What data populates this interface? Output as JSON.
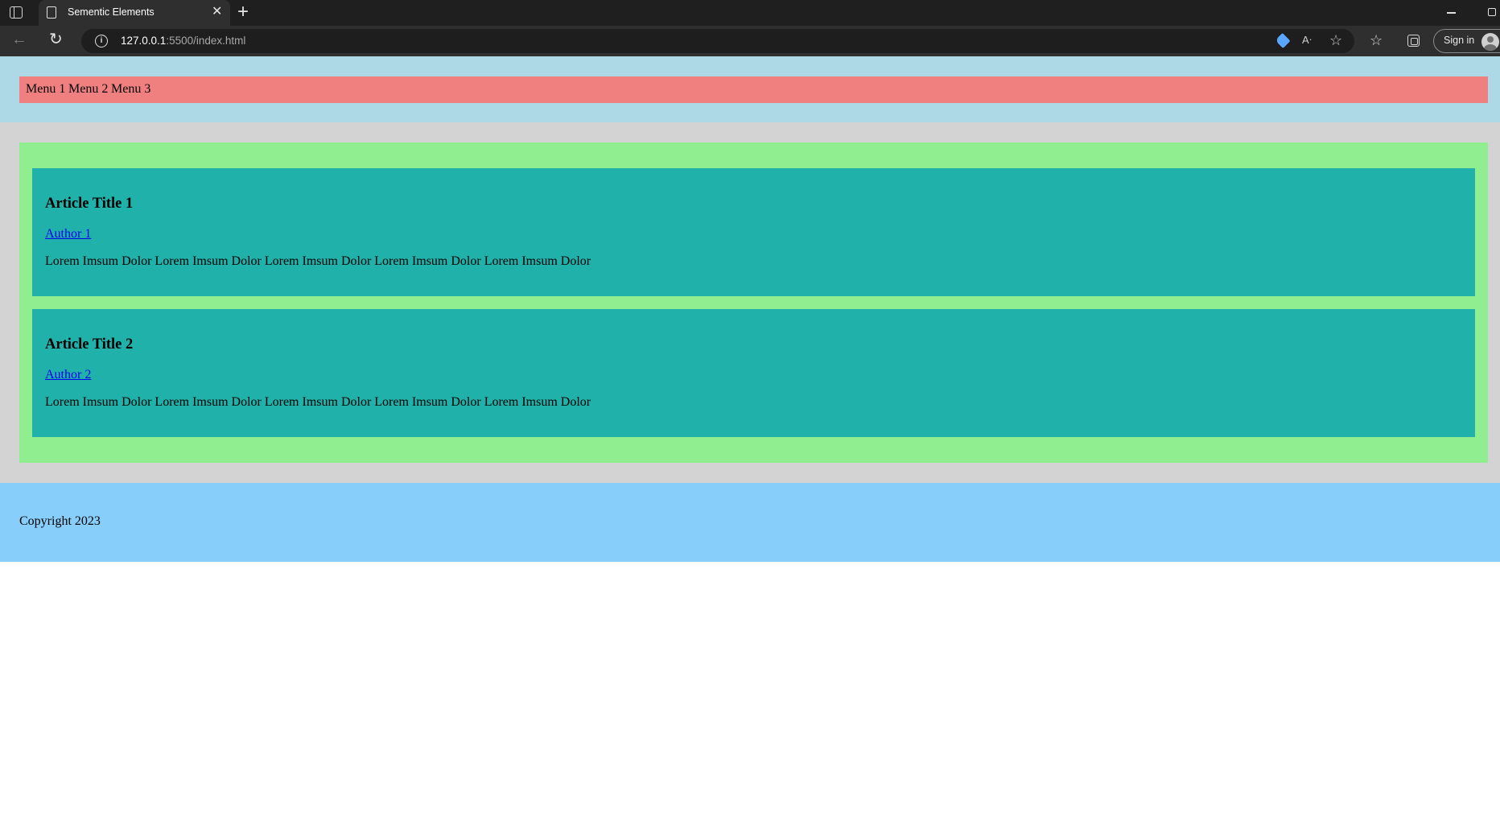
{
  "browser": {
    "tab_title": "Sementic Elements",
    "url_host": "127.0.0.1",
    "url_rest": ":5500/index.html",
    "sign_in_label": "Sign in",
    "icons": {
      "tab_actions": "tab-actions-icon",
      "page": "page-icon",
      "close": "close-icon",
      "new_tab": "plus-icon",
      "back": "back-arrow-icon",
      "refresh": "refresh-icon",
      "site_info": "info-icon",
      "shopping": "tag-icon",
      "read_aloud": "read-aloud-icon",
      "add_favorite": "star-add-icon",
      "favorites": "favorites-icon",
      "collections": "collections-icon",
      "profile": "avatar-icon"
    }
  },
  "header": {
    "menu_items": [
      "Menu 1",
      "Menu 2",
      "Menu 3"
    ]
  },
  "articles": [
    {
      "title": "Article Title 1",
      "author": "Author 1",
      "body": "Lorem Imsum Dolor Lorem Imsum Dolor Lorem Imsum Dolor Lorem Imsum Dolor Lorem Imsum Dolor"
    },
    {
      "title": "Article Title 2",
      "author": "Author 2",
      "body": "Lorem Imsum Dolor Lorem Imsum Dolor Lorem Imsum Dolor Lorem Imsum Dolor Lorem Imsum Dolor"
    }
  ],
  "footer": {
    "copyright": "Copyright 2023"
  },
  "colors": {
    "header_bg": "#add8e6",
    "nav_bg": "#f08080",
    "main_bg": "#d3d3d3",
    "section_bg": "#90ee90",
    "article_bg": "#20b2aa",
    "footer_bg": "#87cefa",
    "link": "#0000ee"
  }
}
